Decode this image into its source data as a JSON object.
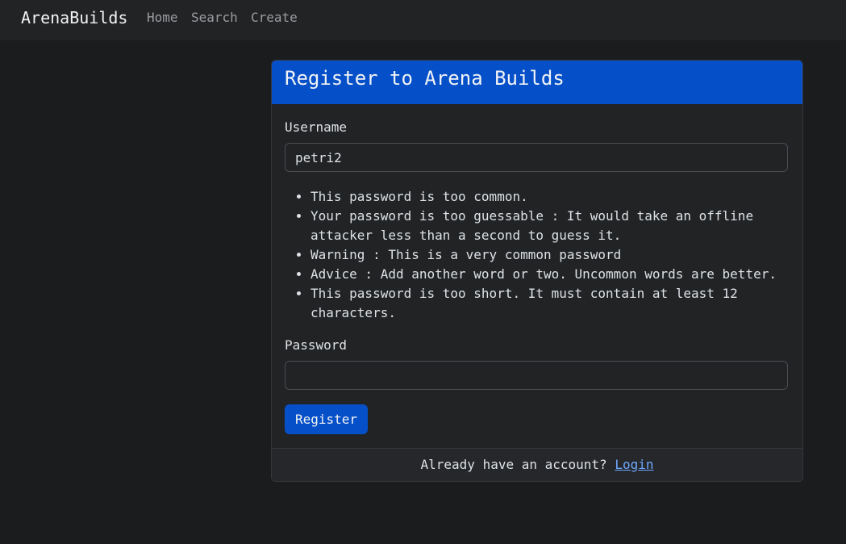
{
  "navbar": {
    "brand": "ArenaBuilds",
    "links": [
      "Home",
      "Search",
      "Create"
    ]
  },
  "card": {
    "title": "Register to Arena Builds",
    "username_label": "Username",
    "username_value": "petri2",
    "errors": [
      "This password is too common.",
      "Your password is too guessable : It would take an offline attacker less than a second to guess it.",
      "Warning : This is a very common password",
      "Advice : Add another word or two. Uncommon words are better.",
      "This password is too short. It must contain at least 12 characters."
    ],
    "password_label": "Password",
    "password_value": "",
    "register_label": "Register",
    "footer_text": "Already have an account?",
    "login_label": "Login"
  },
  "colors": {
    "background": "#1b1c1e",
    "navbar": "#222324",
    "primary": "#0550c9",
    "link": "#6ea8fe"
  }
}
